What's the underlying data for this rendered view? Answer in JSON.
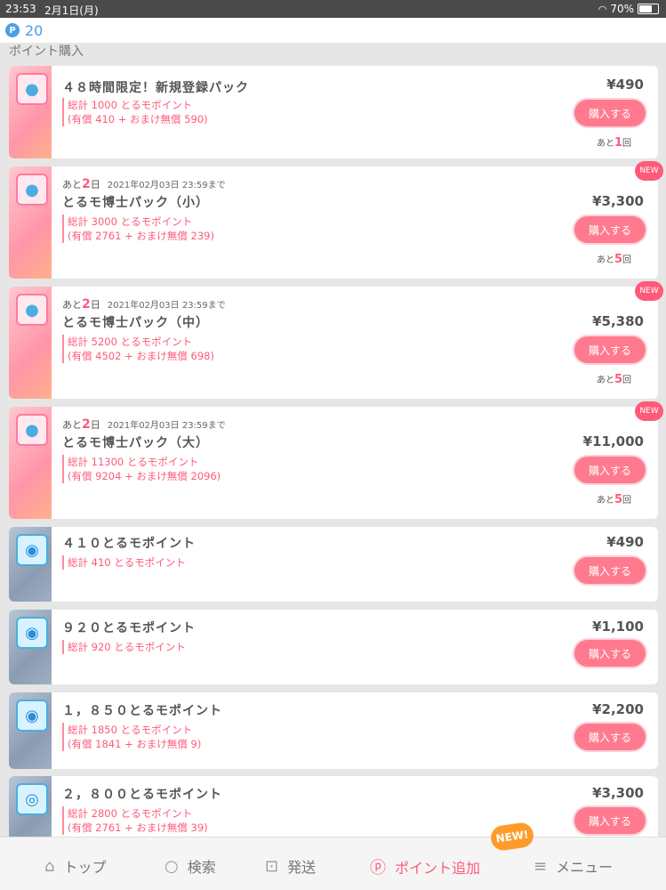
{
  "status": {
    "time": "23:53",
    "date": "2月1日(月)",
    "battery": "70%",
    "battery_level": 0.7
  },
  "points": {
    "icon_label": "P",
    "count": "20"
  },
  "section_title": "ポイント購入",
  "packs": [
    {
      "name": "４８時間限定！新規登録パック",
      "total": "総計 1000 とるモポイント",
      "breakdown": "(有償 410 + おまけ無償 590)",
      "price": "¥490",
      "buy": "購入する",
      "remain_prefix": "あと",
      "remain_num": "1",
      "remain_suffix": "回",
      "icon": "bag-icon"
    },
    {
      "limit_prefix": "あと",
      "limit_num": "2",
      "limit_suffix": "日",
      "deadline": "2021年02月03日 23:59まで",
      "name": "とるモ博士パック（小）",
      "total": "総計 3000 とるモポイント",
      "breakdown": "(有償 2761 + おまけ無償 239)",
      "price": "¥3,300",
      "buy": "購入する",
      "remain_prefix": "あと",
      "remain_num": "5",
      "remain_suffix": "回",
      "new": "NEW",
      "icon": "bag-icon"
    },
    {
      "limit_prefix": "あと",
      "limit_num": "2",
      "limit_suffix": "日",
      "deadline": "2021年02月03日 23:59まで",
      "name": "とるモ博士パック（中）",
      "total": "総計 5200 とるモポイント",
      "breakdown": "(有償 4502 + おまけ無償 698)",
      "price": "¥5,380",
      "buy": "購入する",
      "remain_prefix": "あと",
      "remain_num": "5",
      "remain_suffix": "回",
      "new": "NEW",
      "icon": "bag-icon"
    },
    {
      "limit_prefix": "あと",
      "limit_num": "2",
      "limit_suffix": "日",
      "deadline": "2021年02月03日 23:59まで",
      "name": "とるモ博士パック（大）",
      "total": "総計 11300 とるモポイント",
      "breakdown": "(有償 9204 + おまけ無償 2096)",
      "price": "¥11,000",
      "buy": "購入する",
      "remain_prefix": "あと",
      "remain_num": "5",
      "remain_suffix": "回",
      "new": "NEW",
      "icon": "bag-icon"
    },
    {
      "name": "４１０とるモポイント",
      "total": "総計 410 とるモポイント",
      "price": "¥490",
      "buy": "購入する",
      "icon": "coin-icon"
    },
    {
      "name": "９２０とるモポイント",
      "total": "総計 920 とるモポイント",
      "price": "¥1,100",
      "buy": "購入する",
      "icon": "coin-icon"
    },
    {
      "name": "１，８５０とるモポイント",
      "total": "総計 1850 とるモポイント",
      "breakdown": "(有償 1841 + おまけ無償 9)",
      "price": "¥2,200",
      "buy": "購入する",
      "icon": "coin-icon"
    },
    {
      "name": "２，８００とるモポイント",
      "total": "総計 2800 とるモポイント",
      "breakdown": "(有償 2761 + おまけ無償 39)",
      "price": "¥3,300",
      "buy": "購入する",
      "icon": "coin-stack-icon"
    }
  ],
  "nav": {
    "top": "トップ",
    "search": "検索",
    "ship": "発送",
    "points": "ポイント追加",
    "menu": "メニュー",
    "new": "NEW!"
  }
}
